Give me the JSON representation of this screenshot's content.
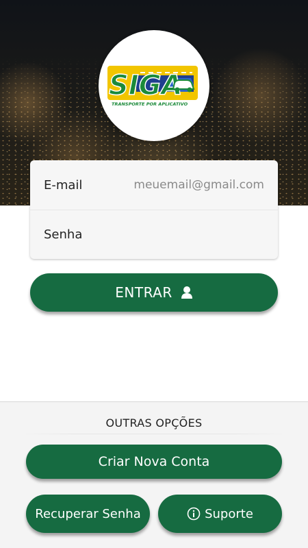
{
  "brand": {
    "logo_text": "SIGA",
    "logo_tagline": "TRANSPORTE POR APLICATIVO",
    "colors": {
      "green": "#1b8a3a",
      "yellow": "#f2c500",
      "blue": "#1f3f8f"
    }
  },
  "login": {
    "email_label": "E-mail",
    "email_placeholder": "meuemail@gmail.com",
    "email_value": "",
    "password_label": "Senha",
    "password_value": "",
    "enter_label": "ENTRAR",
    "enter_icon": "user-icon"
  },
  "options": {
    "title": "OUTRAS OPÇÕES",
    "create_account_label": "Criar Nova Conta",
    "recover_password_label": "Recuperar Senha",
    "support_label": "Suporte",
    "support_icon": "info-icon"
  },
  "theme": {
    "accent": "#166b41",
    "panel_bg": "#f4f4f4"
  }
}
